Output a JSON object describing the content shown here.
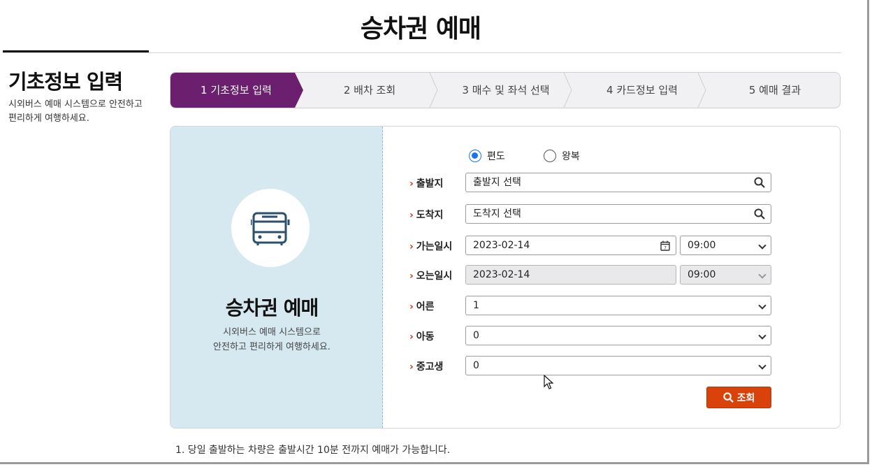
{
  "page_title": "승차권 예매",
  "sidebar": {
    "title": "기초정보 입력",
    "description": "시외버스 예매 시스템으로 안전하고 편리하게 여행하세요."
  },
  "steps": [
    {
      "label": "1 기초정보 입력",
      "active": true
    },
    {
      "label": "2 배차 조회",
      "active": false
    },
    {
      "label": "3 매수 및 좌석 선택",
      "active": false
    },
    {
      "label": "4 카드정보 입력",
      "active": false
    },
    {
      "label": "5 예매 결과",
      "active": false
    }
  ],
  "panel": {
    "icon": "bus-icon",
    "title": "승차권 예매",
    "description_line1": "시외버스 예매 시스템으로",
    "description_line2": "안전하고 편리하게 여행하세요."
  },
  "form": {
    "trip_type": {
      "options": [
        "편도",
        "왕복"
      ],
      "selected": "편도"
    },
    "departure": {
      "label": "출발지",
      "placeholder": "출발지 선택",
      "icon": "search-icon"
    },
    "arrival": {
      "label": "도착지",
      "placeholder": "도착지 선택",
      "icon": "search-icon"
    },
    "go_datetime": {
      "label": "가는일시",
      "date": "2023-02-14",
      "time": "09:00",
      "icon": "calendar-icon"
    },
    "return_datetime": {
      "label": "오는일시",
      "date": "2023-02-14",
      "time": "09:00",
      "disabled": true
    },
    "adult": {
      "label": "어른",
      "value": "1"
    },
    "child": {
      "label": "아동",
      "value": "0"
    },
    "teen": {
      "label": "중고생",
      "value": "0"
    },
    "search_button": "조회"
  },
  "notice": "1. 당일 출발하는 차량은 출발시간 10분 전까지 예매가 가능합니다.",
  "colors": {
    "accent_purple": "#6b1f6e",
    "panel_bg": "#d6e9f1",
    "button_orange": "#d9420b",
    "label_mark": "#c8321e",
    "radio_blue": "#1a73e8"
  }
}
